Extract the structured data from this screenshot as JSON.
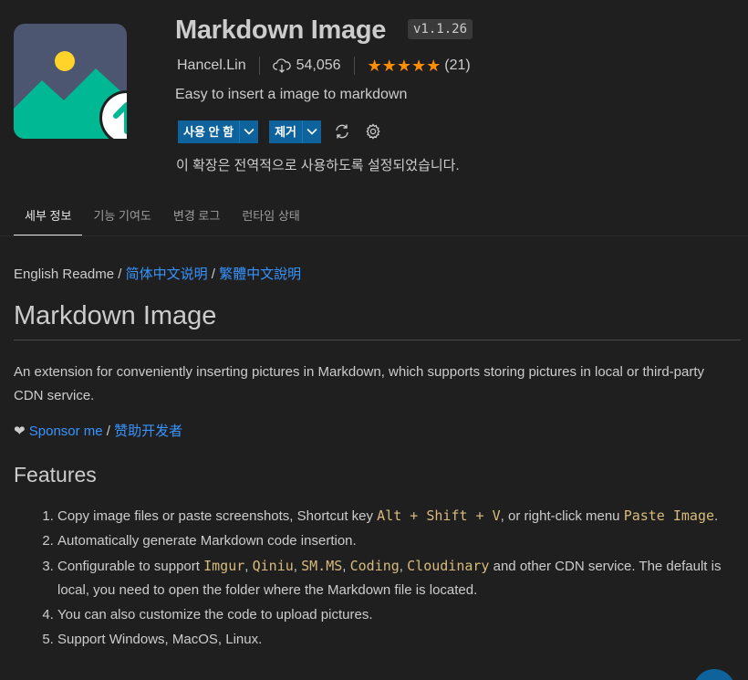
{
  "header": {
    "name": "Markdown Image",
    "version": "v1.1.26",
    "publisher": "Hancel.Lin",
    "downloads": "54,056",
    "stars": "★★★★★",
    "rating_count": "(21)",
    "description": "Easy to insert a image to markdown",
    "disable_label": "사용 안 함",
    "uninstall_label": "제거",
    "scope_note": "이 확장은 전역적으로 사용하도록 설정되었습니다."
  },
  "colors": {
    "button": "#0e639c",
    "link": "#3794ff",
    "star": "#ff8e00",
    "code": "#d7ba7d",
    "logo_bg": "#4c5670",
    "logo_mountain": "#00b894",
    "logo_sun": "#ffd32a"
  },
  "icons": [
    "download-cloud-icon",
    "chevron-down-icon",
    "sync-icon",
    "gear-icon",
    "upload-arrow-icon"
  ],
  "tabs": [
    {
      "label": "세부 정보",
      "active": true
    },
    {
      "label": "기능 기여도",
      "active": false
    },
    {
      "label": "변경 로그",
      "active": false
    },
    {
      "label": "런타임 상태",
      "active": false
    }
  ],
  "readme": {
    "lang_prefix": "English Readme",
    "sep": " / ",
    "lang_links": [
      "简体中文说明",
      "繁體中文說明"
    ],
    "title": "Markdown Image",
    "intro": "An extension for conveniently inserting pictures in Markdown, which supports storing pictures in local or third-party CDN service.",
    "heart": "❤",
    "sponsor_link": "Sponsor me",
    "sponsor_cn_link": "赞助开发者",
    "features_title": "Features",
    "features": {
      "f1_text_a": "Copy image files or paste screenshots, Shortcut key ",
      "f1_code_shortcut": "Alt + Shift + V",
      "f1_text_b": ", or right-click menu ",
      "f1_code_menu": "Paste Image",
      "f1_text_c": ".",
      "f2": "Automatically generate Markdown code insertion.",
      "f3_text_a": "Configurable to support ",
      "f3_codes": [
        "Imgur",
        "Qiniu",
        "SM.MS",
        "Coding",
        "Cloudinary"
      ],
      "f3_comma": ", ",
      "f3_text_b": " and other CDN service. The default is local, you need to open the folder where the Markdown file is located.",
      "f4": "You can also customize the code to upload pictures.",
      "f5": "Support Windows, MacOS, Linux."
    }
  }
}
